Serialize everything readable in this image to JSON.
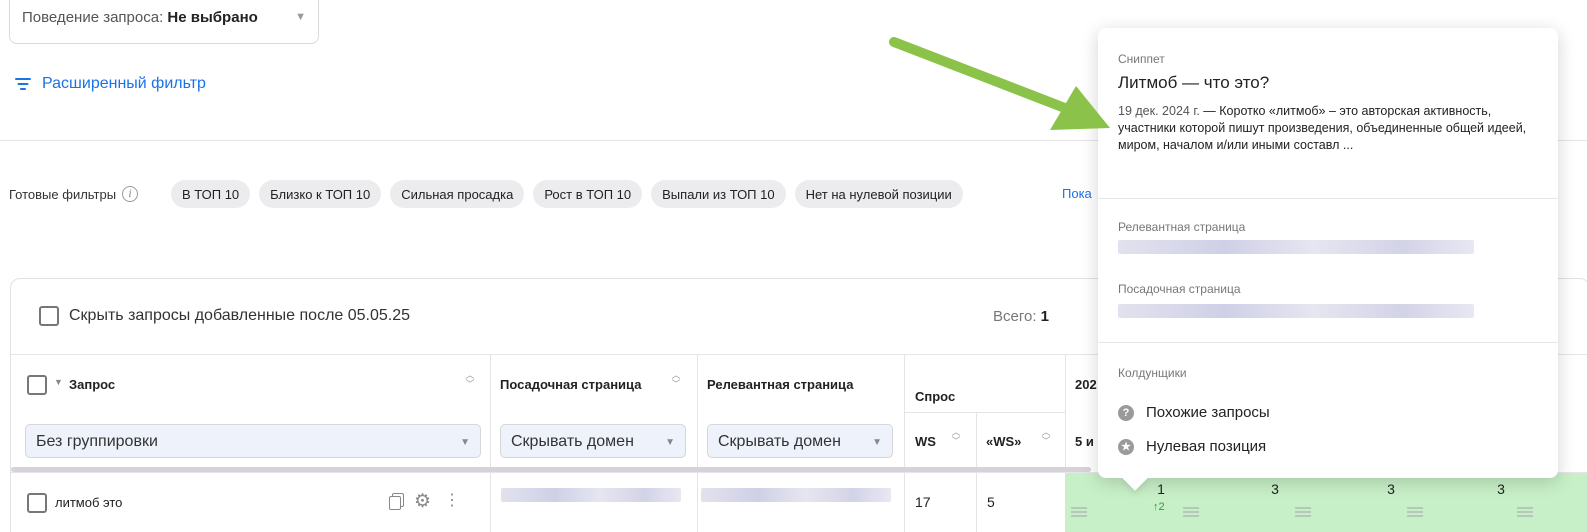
{
  "top_select": {
    "prefix": "Поведение запроса:",
    "value": "Не выбрано"
  },
  "advanced_filter": {
    "label": "Расширенный фильтр"
  },
  "presets": {
    "label": "Готовые фильтры",
    "chips": [
      "В ТОП 10",
      "Близко к ТОП 10",
      "Сильная просадка",
      "Рост в ТОП 10",
      "Выпали из ТОП 10",
      "Нет на нулевой позиции"
    ],
    "more_link": "Пока"
  },
  "table": {
    "hide_checkbox_label": "Скрыть запросы добавленные после 05.05.25",
    "total_label": "Всего:",
    "total_value": "1",
    "headers": {
      "query": "Запрос",
      "landing": "Посадочная страница",
      "relevant": "Релевантная страница",
      "demand": "Спрос",
      "year_partial": "202",
      "ws": "WS",
      "ws_quoted": "«WS»",
      "five_partial": "5 и"
    },
    "selects": {
      "grouping": "Без группировки",
      "landing_domain": "Скрывать домен",
      "relevant_domain": "Скрывать домен"
    },
    "rows": [
      {
        "query": "литмоб это",
        "ws": "17",
        "ws_quoted": "5",
        "pos1": "1",
        "delta1": "↑2",
        "pos2": "3",
        "pos3": "3",
        "pos4": "3"
      }
    ]
  },
  "popover": {
    "snippet_label": "Сниппет",
    "snippet_title": "Литмоб — что это?",
    "snippet_date": "19 дек. 2024 г.",
    "snippet_text": " — Коротко «литмоб» – это авторская активность, участники которой пишут произведения, объединенные общей идеей, миром, началом и/или иными составл ...",
    "relevant_label": "Релевантная страница",
    "landing_label": "Посадочная страница",
    "wizards_label": "Колдунщики",
    "wizards": [
      {
        "label": "Похожие запросы",
        "icon": "question-circle-icon"
      },
      {
        "label": "Нулевая позиция",
        "icon": "star-circle-icon"
      }
    ]
  },
  "colors": {
    "accent": "#1a73e8",
    "green_cell": "#c8f0c8",
    "arrow": "#8bc34a"
  }
}
